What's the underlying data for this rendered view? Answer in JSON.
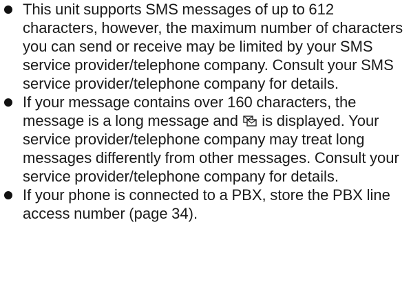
{
  "notes": [
    {
      "text": "This unit supports SMS messages of up to 612 characters, however, the maximum number of characters you can send or receive may be limited by your SMS service provider/telephone company. Consult your SMS service provider/telephone company for details."
    },
    {
      "text_before_icon": "If your message contains over 160 characters, the message is a long message and",
      "icon": "long-message-icon",
      "text_after_icon": "is displayed. Your service provider/telephone company may treat long messages differently from other messages. Consult your service provider/telephone company for details."
    },
    {
      "text": "If your phone is connected to a PBX, store the PBX line access number (page 34)."
    }
  ]
}
